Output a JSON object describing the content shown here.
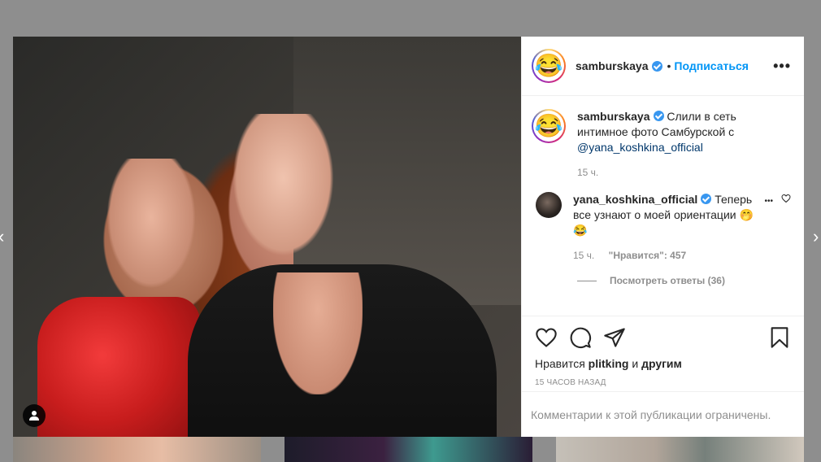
{
  "post": {
    "author": "samburskaya",
    "follow_label": "Подписаться",
    "dot": "•",
    "caption": {
      "username": "samburskaya",
      "text_before": "Слили в сеть интимное фото Самбурской с ",
      "mention": "@yana_koshkina_official",
      "time": "15 ч."
    },
    "comments": [
      {
        "username": "yana_koshkina_official",
        "text": "Теперь все узнают о моей ориентации 🤭😂",
        "time": "15 ч.",
        "likes_label": "\"Нравится\": 457",
        "view_replies": "Посмотреть ответы (36)"
      }
    ],
    "likes": {
      "prefix": "Нравится ",
      "user": "plitking",
      "middle": " и ",
      "others": "другим"
    },
    "timestamp": "15 часов назад",
    "comments_restricted": "Комментарии к этой публикации ограничены."
  },
  "icons": {
    "avatar_emoji": "😂",
    "more": "•••",
    "heart": "heart-icon",
    "comment": "comment-icon",
    "share": "share-icon",
    "bookmark": "bookmark-icon",
    "user_tag": "user-icon",
    "nav_left": "‹",
    "nav_right": "›"
  },
  "colors": {
    "accent": "#0095f6",
    "verified": "#3897f0",
    "muted": "#8e8e8e"
  }
}
